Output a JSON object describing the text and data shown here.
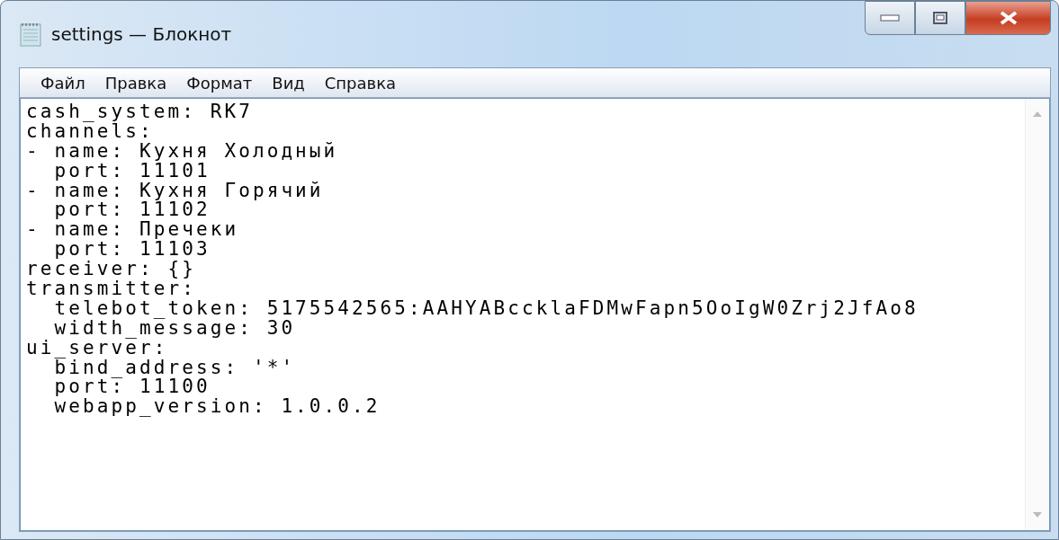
{
  "window": {
    "title": "settings — Блокнот"
  },
  "menu": [
    "Файл",
    "Правка",
    "Формат",
    "Вид",
    "Справка"
  ],
  "editor": {
    "lines": [
      "cash_system: RK7",
      "channels:",
      "- name: Кухня Холодный",
      "  port: 11101",
      "- name: Кухня Горячий",
      "  port: 11102",
      "- name: Пречеки",
      "  port: 11103",
      "receiver: {}",
      "transmitter:",
      "  telebot_token: 5175542565:AAHYABccklaFDMwFapn5OoIgW0Zrj2JfAo8",
      "  width_message: 30",
      "ui_server:",
      "  bind_address: '*'",
      "  port: 11100",
      "  webapp_version: 1.0.0.2"
    ]
  }
}
